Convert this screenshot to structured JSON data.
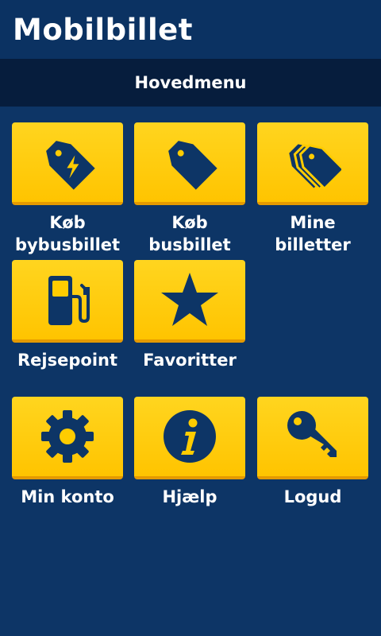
{
  "header": {
    "title": "Mobilbillet"
  },
  "menu": {
    "title": "Hovedmenu",
    "items": [
      {
        "label": "Køb\nbybusbillet",
        "icon": "tag-lightning-icon"
      },
      {
        "label": "Køb\nbusbillet",
        "icon": "tag-icon"
      },
      {
        "label": "Mine\nbilletter",
        "icon": "tags-icon"
      },
      {
        "label": "Rejsepoint",
        "icon": "fuel-pump-icon"
      },
      {
        "label": "Favoritter",
        "icon": "star-icon"
      },
      {
        "label": "Min konto",
        "icon": "gear-icon"
      },
      {
        "label": "Hjælp",
        "icon": "info-icon"
      },
      {
        "label": "Logud",
        "icon": "key-icon"
      }
    ]
  },
  "colors": {
    "background": "#0d3566",
    "header_bar": "#061d3d",
    "tile": "#ffcc00",
    "icon": "#0d3566",
    "text": "#ffffff"
  }
}
